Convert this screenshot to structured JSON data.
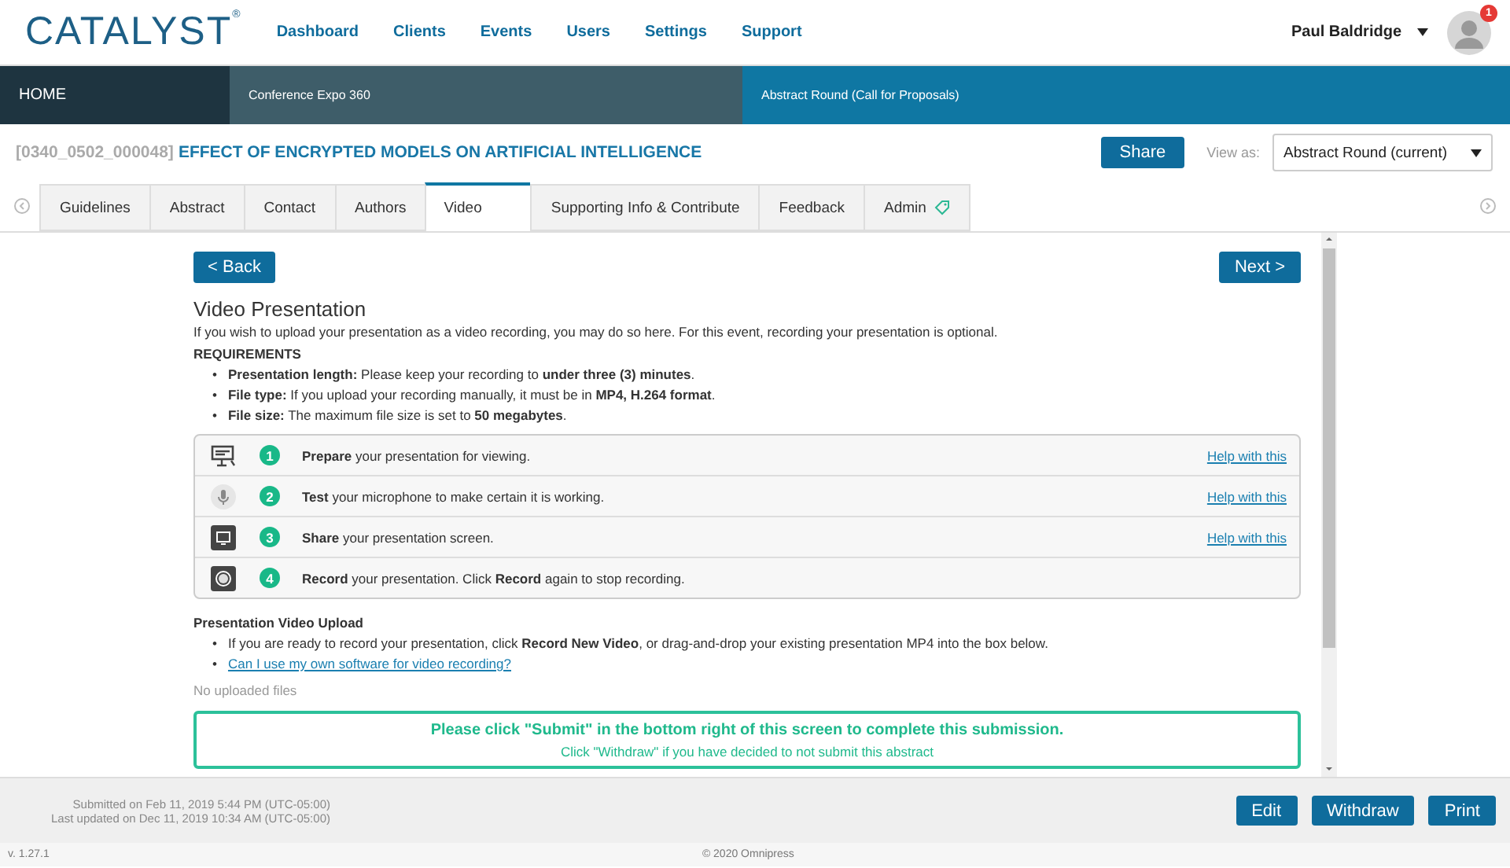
{
  "header": {
    "logo": "CATALYST",
    "logo_mark": "®",
    "nav": [
      "Dashboard",
      "Clients",
      "Events",
      "Users",
      "Settings",
      "Support"
    ],
    "user": "Paul Baldridge",
    "notifications": "1"
  },
  "breadcrumb": [
    "HOME",
    "Conference Expo 360",
    "Abstract Round (Call for Proposals)"
  ],
  "record": {
    "id": "[0340_0502_000048]",
    "title": "EFFECT OF ENCRYPTED MODELS ON ARTIFICIAL INTELLIGENCE",
    "share": "Share",
    "view_as_label": "View as:",
    "view_as": "Abstract Round (current)"
  },
  "tabs": [
    {
      "label": "Guidelines",
      "selected": false
    },
    {
      "label": "Abstract",
      "selected": false
    },
    {
      "label": "Contact",
      "selected": false
    },
    {
      "label": "Authors",
      "selected": false
    },
    {
      "label": "Video",
      "selected": true
    },
    {
      "label": "Supporting Info & Contribute",
      "selected": false
    },
    {
      "label": "Feedback",
      "selected": false
    },
    {
      "label": "Admin",
      "selected": false,
      "kind": "tagged"
    }
  ],
  "content": {
    "back": "< Back",
    "next": "Next >",
    "heading": "Video Presentation",
    "intro": "If you wish to upload your presentation as a video recording, you may do so here. For this event, recording your presentation is optional.",
    "requirements_heading": "REQUIREMENTS",
    "bullet": "•",
    "requirements": [
      "**Presentation length:** Please keep your recording to **under three (3) minutes**.",
      "**File type:** If you upload your recording manually, it must be in **MP4, H.264 format**.",
      "**File size:** The maximum file size is set to **50 megabytes**."
    ],
    "steps": [
      {
        "kind": "presentation",
        "number": "1",
        "text": "**Prepare** your presentation for viewing.",
        "help": "Help with this"
      },
      {
        "kind": "microphone",
        "number": "2",
        "text": "**Test** your microphone to make certain it is working.",
        "help": "Help with this"
      },
      {
        "kind": "screen",
        "number": "3",
        "text": "**Share** your presentation screen.",
        "help": "Help with this"
      },
      {
        "kind": "record",
        "number": "4",
        "text": "**Record** your presentation. Click **Record** again to stop recording."
      }
    ],
    "upload_heading": "Presentation Video Upload",
    "upload_items": [
      {
        "kind": "text",
        "text": "If you are ready to record your presentation, click **Record New Video**, or drag-and-drop your existing presentation MP4 into the box below."
      },
      {
        "kind": "link",
        "text": "Can I use my own software for video recording?"
      }
    ],
    "no_files": "No uploaded files",
    "notice": "Please click \"Submit\" in the bottom right of this screen to complete this submission.",
    "notice_sub": "Click \"Withdraw\" if you have decided to not submit this abstract"
  },
  "footer": {
    "submitted": "Submitted on Feb 11, 2019 5:44 PM (UTC-05:00)",
    "updated": "Last updated on Dec 11, 2019 10:34 AM (UTC-05:00)",
    "buttons": [
      "Edit",
      "Withdraw",
      "Print"
    ],
    "version": "v. 1.27.1",
    "copyright": "© 2020 Omnipress"
  }
}
